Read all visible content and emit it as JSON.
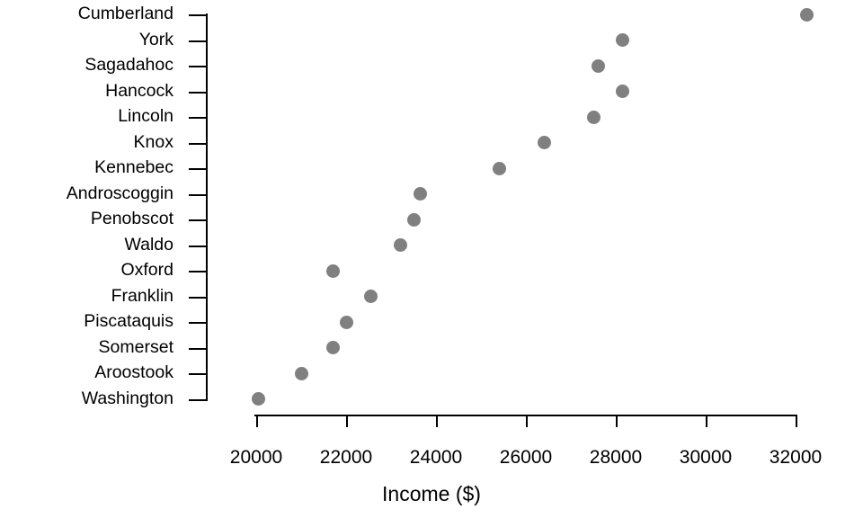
{
  "chart_data": {
    "type": "scatter",
    "title": "",
    "xlabel": "Income ($)",
    "ylabel": "",
    "xlim": [
      20000,
      32000
    ],
    "xticks": [
      20000,
      22000,
      24000,
      26000,
      28000,
      30000,
      32000
    ],
    "xticklabels": [
      "20000",
      "22000",
      "24000",
      "26000",
      "28000",
      "30000",
      "32000"
    ],
    "categories": [
      "Cumberland",
      "York",
      "Sagadahoc",
      "Hancock",
      "Lincoln",
      "Knox",
      "Kennebec",
      "Androscoggin",
      "Penobscot",
      "Waldo",
      "Oxford",
      "Franklin",
      "Piscataquis",
      "Somerset",
      "Aroostook",
      "Washington"
    ],
    "values": [
      32250,
      28150,
      27600,
      28150,
      27500,
      26400,
      25400,
      23650,
      23500,
      23200,
      21700,
      22550,
      22000,
      21700,
      21000,
      20050
    ],
    "grid": false,
    "legend": null,
    "point_color": "#808080",
    "axis_color": "#000000"
  }
}
